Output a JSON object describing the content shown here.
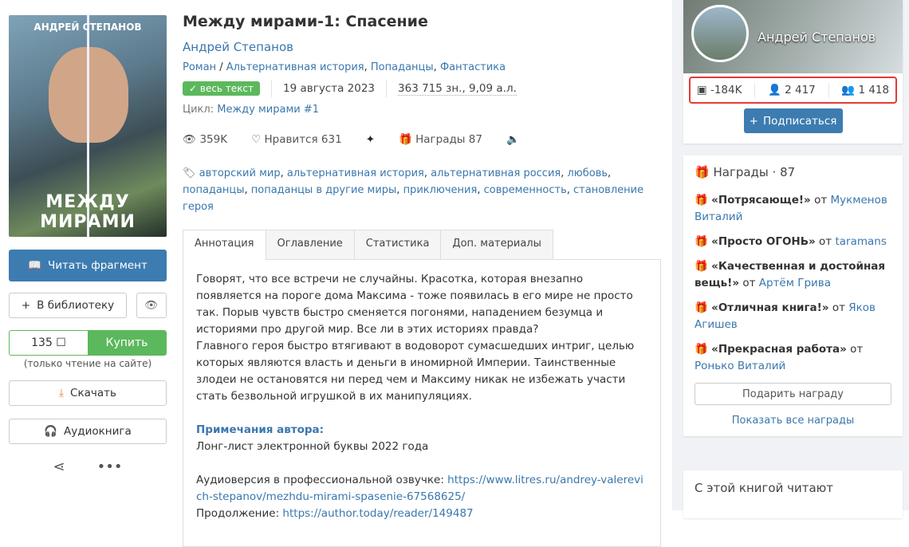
{
  "cover": {
    "author": "АНДРЕЙ СТЕПАНОВ",
    "title": "МЕЖДУ МИРАМИ"
  },
  "left": {
    "read_fragment": "Читать фрагмент",
    "library": "В библиотеку",
    "price": "135 ☐",
    "buy": "Купить",
    "buy_note": "(только чтение на сайте)",
    "download": "Скачать",
    "audiobook": "Аудиокнига"
  },
  "book": {
    "title": "Между мирами-1: Спасение",
    "author": "Андрей Степанов",
    "genres": [
      "Роман",
      "Альтернативная история",
      "Попаданцы",
      "Фантастика"
    ],
    "badge": "весь текст",
    "date": "19 августа 2023",
    "size": "363 715 зн., 9,09 а.л.",
    "cycle_label": "Цикл:",
    "cycle": "Между мирами #1",
    "views": "359K",
    "likes_label": "Нравится",
    "likes": "631",
    "awards_label": "Награды",
    "awards": "87",
    "tags": [
      "авторский мир",
      "альтернативная история",
      "альтернативная россия",
      "любовь",
      "попаданцы",
      "попаданцы в другие миры",
      "приключения",
      "современность",
      "становление героя"
    ]
  },
  "tabs": [
    "Аннотация",
    "Оглавление",
    "Статистика",
    "Доп. материалы"
  ],
  "annotation": {
    "p1": "Говорят, что все встречи не случайны. Красотка, которая внезапно появляется на пороге дома Максима - тоже появилась в его мире не просто так. Порыв чувств быстро сменяется погонями, нападением безумца и историями про другой мир. Все ли в этих историях правда?",
    "p2": "Главного героя быстро втягивают в водоворот сумасшедших интриг, целью которых являются власть и деньги в иномирной Империи. Таинственные злодеи не остановятся ни перед чем и Максиму никак не избежать участи стать безвольной игрушкой в их манипуляциях.",
    "notes_title": "Примечания автора:",
    "note1": "Лонг-лист электронной буквы 2022 года",
    "audio_label": "Аудиоверсия в профессиональной озвучке:",
    "audio_link": "https://www.litres.ru/andrey-valerevich-stepanov/mezhdu-mirami-spasenie-67568625/",
    "cont_label": "Продолжение:",
    "cont_link": "https://author.today/reader/149487"
  },
  "profile": {
    "name": "Андрей Степанов",
    "books": "-184K",
    "subscribers": "2 417",
    "friends": "1 418",
    "subscribe": "Подписаться"
  },
  "awards_card": {
    "title": "Награды",
    "count": "87",
    "items": [
      {
        "name": "«Потрясающе!»",
        "from": "от",
        "user": "Мукменов Виталий"
      },
      {
        "name": "«Просто ОГОНЬ»",
        "from": "от",
        "user": "taramans"
      },
      {
        "name": "«Качественная и достойная вещь!»",
        "from": "от",
        "user": "Артём Грива"
      },
      {
        "name": "«Отличная книга!»",
        "from": "от",
        "user": "Яков Агишев"
      },
      {
        "name": "«Прекрасная работа»",
        "from": "от",
        "user": "Ронько Виталий"
      }
    ],
    "give": "Подарить награду",
    "show_all": "Показать все награды"
  },
  "readers": {
    "title": "С этой книгой читают"
  }
}
